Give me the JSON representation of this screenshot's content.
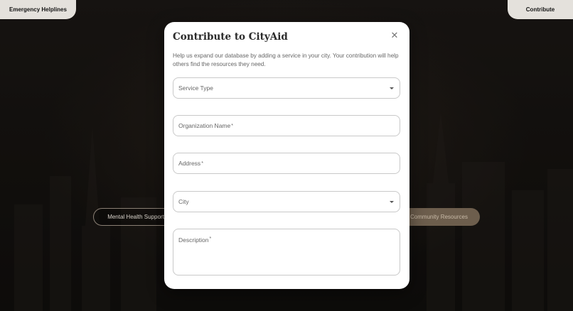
{
  "header": {
    "emergency_label": "Emergency Helplines",
    "contribute_label": "Contribute"
  },
  "categories": {
    "mental_health": "Mental Health Support",
    "community": "Community Resources"
  },
  "modal": {
    "title": "Contribute to CityAid",
    "description": "Help us expand our database by adding a service in your city. Your contribution will help others find the resources they need.",
    "close_icon": "close-icon",
    "fields": {
      "service_type": "Service Type",
      "organization_name": "Organization Name",
      "address": "Address",
      "city": "City",
      "description": "Description"
    },
    "required_mark": "*"
  }
}
